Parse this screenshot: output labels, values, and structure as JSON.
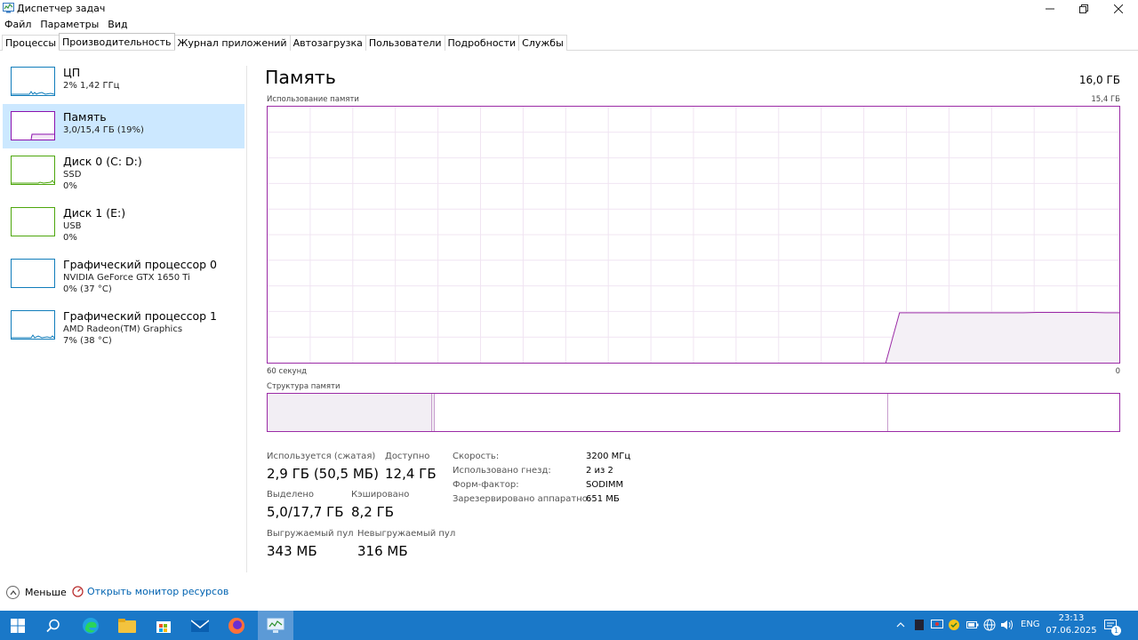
{
  "window": {
    "title": "Диспетчер задач"
  },
  "menu": [
    "Файл",
    "Параметры",
    "Вид"
  ],
  "tabs": [
    "Процессы",
    "Производительность",
    "Журнал приложений",
    "Автозагрузка",
    "Пользователи",
    "Подробности",
    "Службы"
  ],
  "active_tab": "Производительность",
  "sidebar": [
    {
      "title": "ЦП",
      "sub1": "2% 1,42 ГГц",
      "sub2": "",
      "color": "#117dbb",
      "selected": false
    },
    {
      "title": "Память",
      "sub1": "3,0/15,4 ГБ (19%)",
      "sub2": "",
      "color": "#8b12ae",
      "selected": true
    },
    {
      "title": "Диск 0 (C: D:)",
      "sub1": "SSD",
      "sub2": "0%",
      "color": "#4da60c",
      "selected": false
    },
    {
      "title": "Диск 1 (E:)",
      "sub1": "USB",
      "sub2": "0%",
      "color": "#4da60c",
      "selected": false
    },
    {
      "title": "Графический процессор 0",
      "sub1": "NVIDIA GeForce GTX 1650 Ti",
      "sub2": "0% (37 °C)",
      "color": "#117dbb",
      "selected": false
    },
    {
      "title": "Графический процессор 1",
      "sub1": "AMD Radeon(TM) Graphics",
      "sub2": "7% (38 °C)",
      "color": "#117dbb",
      "selected": false
    }
  ],
  "main": {
    "title": "Память",
    "total": "16,0 ГБ",
    "graph_label": "Использование памяти",
    "graph_max": "15,4 ГБ",
    "time_left": "60 секунд",
    "time_right": "0",
    "composition_label": "Структура памяти",
    "usage_history_percent": [
      0,
      0,
      0,
      0,
      0,
      0,
      0,
      0,
      0,
      0,
      0,
      0,
      0,
      0,
      0,
      0,
      0,
      0,
      0,
      0,
      0,
      0,
      0,
      0,
      0,
      0,
      0,
      0,
      0,
      0,
      0,
      0,
      0,
      0,
      0,
      0,
      0,
      0,
      0,
      0,
      0,
      0,
      0,
      0,
      0,
      0,
      19.5,
      19.5,
      19.5,
      19.5,
      19.5,
      19.5,
      19.5,
      19.5,
      19.5,
      19.5,
      19.6,
      19.6,
      19.6,
      19.6,
      19.6,
      19.5,
      19.5
    ],
    "stats": {
      "in_use_label": "Используется (сжатая)",
      "in_use_value": "2,9 ГБ (50,5 МБ)",
      "available_label": "Доступно",
      "available_value": "12,4 ГБ",
      "committed_label": "Выделено",
      "committed_value": "5,0/17,7 ГБ",
      "cached_label": "Кэшировано",
      "cached_value": "8,2 ГБ",
      "paged_label": "Выгружаемый пул",
      "paged_value": "343 МБ",
      "nonpaged_label": "Невыгружаемый пул",
      "nonpaged_value": "316 МБ"
    },
    "props": [
      {
        "label": "Скорость:",
        "value": "3200 МГц"
      },
      {
        "label": "Использовано гнезд:",
        "value": "2 из 2"
      },
      {
        "label": "Форм-фактор:",
        "value": "SODIMM"
      },
      {
        "label": "Зарезервировано аппаратно:",
        "value": "651 МБ"
      }
    ]
  },
  "footer": {
    "fewer": "Меньше",
    "monitor": "Открыть монитор ресурсов"
  },
  "taskbar": {
    "language": "ENG",
    "time": "23:13",
    "date": "07.06.2025",
    "notifications": "1"
  }
}
